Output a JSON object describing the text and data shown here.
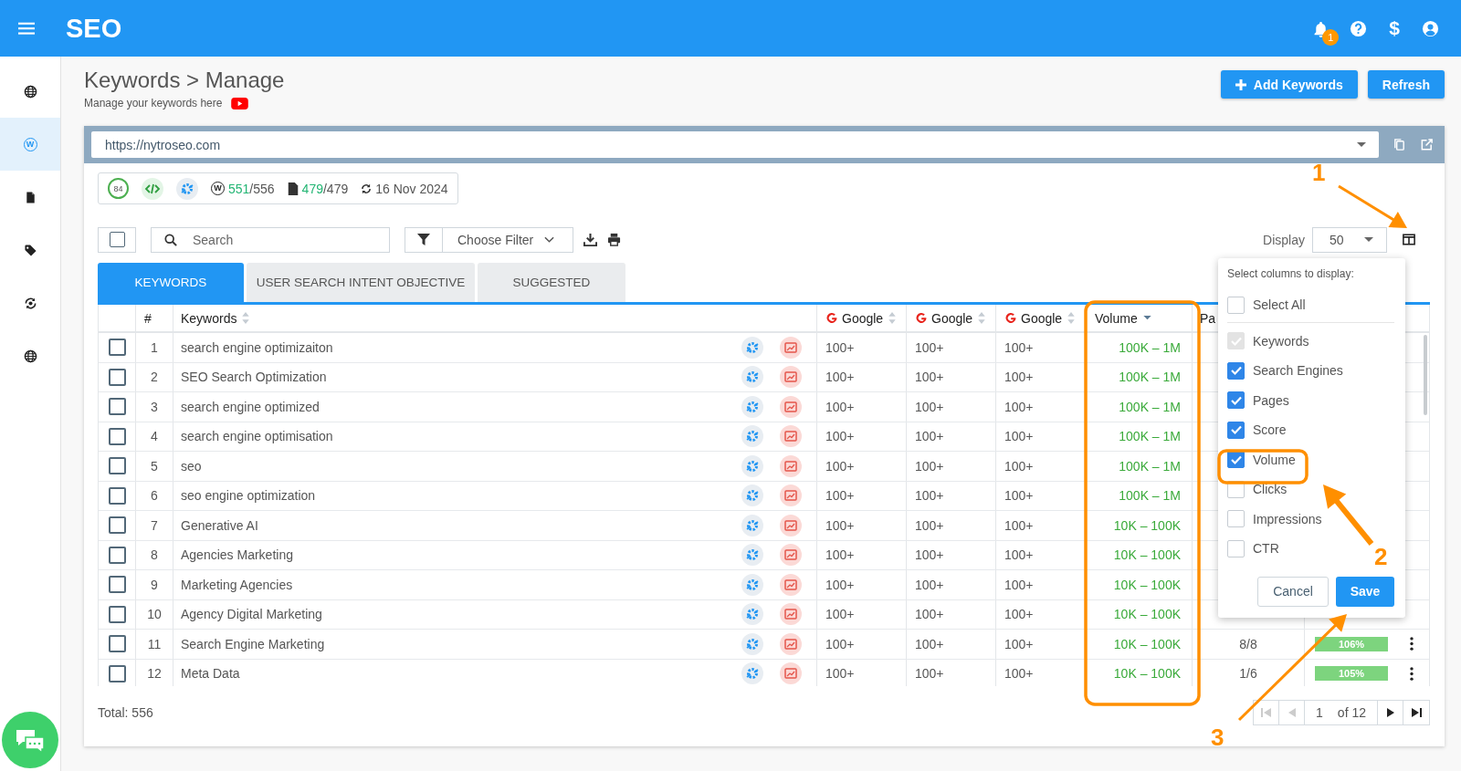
{
  "topbar": {
    "title": "SEO",
    "notification_count": "1",
    "currency_symbol": "$"
  },
  "sidebar": {
    "items": [
      {
        "kind": "globe",
        "selected": false
      },
      {
        "kind": "site",
        "letter": "W",
        "selected": true
      },
      {
        "kind": "file",
        "selected": false
      },
      {
        "kind": "tag",
        "selected": false
      },
      {
        "kind": "sync",
        "selected": false
      },
      {
        "kind": "globe",
        "selected": false
      }
    ]
  },
  "page": {
    "title": "Keywords",
    "separator": ">",
    "breadcrumb": "Manage",
    "subtitle": "Manage your keywords here"
  },
  "buttons": [
    {
      "label": "Add Keywords",
      "kind": "add"
    },
    {
      "label": "Refresh",
      "kind": "plain"
    }
  ],
  "url": {
    "value": "https://nytroseo.com"
  },
  "stats": {
    "score": "84",
    "site_letter": "W",
    "site_done": "551",
    "site_total": "/556",
    "pages_done": "479",
    "pages_total": "/479",
    "date": "16 Nov 2024"
  },
  "toolbar": {
    "select_all_checked": false,
    "search_placeholder": "Search",
    "filter": "Choose Filter",
    "display_label": "Display",
    "display_value": "50"
  },
  "tabs": [
    {
      "label": "KEYWORDS",
      "selected": true
    },
    {
      "label": "USER SEARCH INTENT OBJECTIVE",
      "selected": false
    },
    {
      "label": "SUGGESTED",
      "selected": false
    }
  ],
  "table": {
    "columns": [
      {
        "label": "#",
        "kind": "number"
      },
      {
        "label": "Keywords",
        "kind": "keyword",
        "sortable": true,
        "sorted_descending": false
      },
      {
        "label": "Google",
        "kind": "engine",
        "sortable": true,
        "sorted_descending": false
      },
      {
        "label": "Google",
        "kind": "engine",
        "sortable": true,
        "sorted_descending": false
      },
      {
        "label": "Google",
        "kind": "engine",
        "sortable": true,
        "sorted_descending": false
      },
      {
        "label": "Volume",
        "kind": "volume",
        "sortable": true,
        "sorted_descending": true
      },
      {
        "label": "Pa",
        "kind": "pages"
      }
    ],
    "rows": [
      {
        "number": "1",
        "keyword": "search engine optimizaiton",
        "engines": [
          "100+",
          "100+",
          "100+"
        ],
        "volume": "100K – 1M",
        "checked": false
      },
      {
        "number": "2",
        "keyword": "SEO Search Optimization",
        "engines": [
          "100+",
          "100+",
          "100+"
        ],
        "volume": "100K – 1M",
        "checked": false
      },
      {
        "number": "3",
        "keyword": "search engine optimized",
        "engines": [
          "100+",
          "100+",
          "100+"
        ],
        "volume": "100K – 1M",
        "checked": false
      },
      {
        "number": "4",
        "keyword": "search engine optimisation",
        "engines": [
          "100+",
          "100+",
          "100+"
        ],
        "volume": "100K – 1M",
        "checked": false
      },
      {
        "number": "5",
        "keyword": "seo",
        "engines": [
          "100+",
          "100+",
          "100+"
        ],
        "volume": "100K – 1M",
        "checked": false
      },
      {
        "number": "6",
        "keyword": "seo engine optimization",
        "engines": [
          "100+",
          "100+",
          "100+"
        ],
        "volume": "100K – 1M",
        "checked": false
      },
      {
        "number": "7",
        "keyword": "Generative AI",
        "engines": [
          "100+",
          "100+",
          "100+"
        ],
        "volume": "10K – 100K",
        "checked": false
      },
      {
        "number": "8",
        "keyword": "Agencies Marketing",
        "engines": [
          "100+",
          "100+",
          "100+"
        ],
        "volume": "10K – 100K",
        "checked": false
      },
      {
        "number": "9",
        "keyword": "Marketing Agencies",
        "engines": [
          "100+",
          "100+",
          "100+"
        ],
        "volume": "10K – 100K",
        "checked": false
      },
      {
        "number": "10",
        "keyword": "Agency Digital Marketing",
        "engines": [
          "100+",
          "100+",
          "100+"
        ],
        "volume": "10K – 100K",
        "checked": false
      },
      {
        "number": "11",
        "keyword": "Search Engine Marketing",
        "engines": [
          "100+",
          "100+",
          "100+"
        ],
        "volume": "10K – 100K",
        "pages": "8/8",
        "score": "106%",
        "checked": false
      },
      {
        "number": "12",
        "keyword": "Meta Data",
        "engines": [
          "100+",
          "100+",
          "100+"
        ],
        "volume": "10K – 100K",
        "pages": "1/6",
        "score": "105%",
        "checked": false
      }
    ]
  },
  "total": "Total: 556",
  "pagination": {
    "page": "1",
    "of": "of 12"
  },
  "column_picker": {
    "title": "Select columns to display:",
    "options": [
      {
        "label": "Select All",
        "checked": false,
        "disabled": false
      },
      {
        "label": "Keywords",
        "checked": true,
        "disabled": true
      },
      {
        "label": "Search Engines",
        "checked": true,
        "disabled": false
      },
      {
        "label": "Pages",
        "checked": true,
        "disabled": false
      },
      {
        "label": "Score",
        "checked": true,
        "disabled": false
      },
      {
        "label": "Volume",
        "checked": true,
        "disabled": false
      },
      {
        "label": "Clicks",
        "checked": false,
        "disabled": false
      },
      {
        "label": "Impressions",
        "checked": false,
        "disabled": false
      },
      {
        "label": "CTR",
        "checked": false,
        "disabled": false
      }
    ],
    "cancel": "Cancel",
    "save": "Save"
  },
  "annotations": [
    {
      "label": "1"
    },
    {
      "label": "2"
    },
    {
      "label": "3"
    }
  ]
}
